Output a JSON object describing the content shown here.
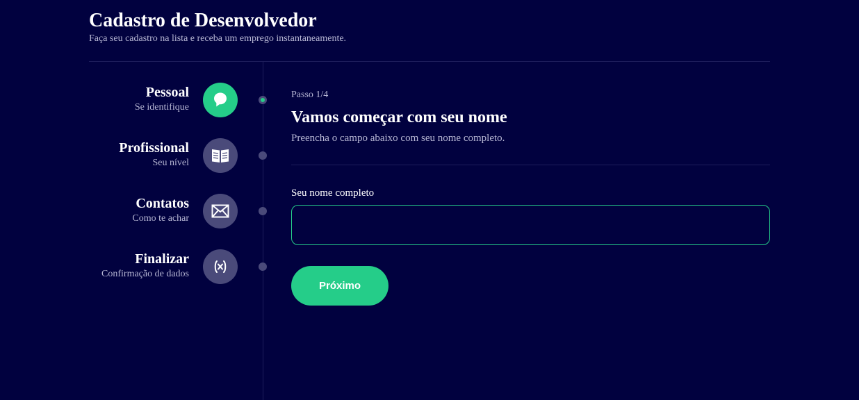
{
  "header": {
    "title": "Cadastro de Desenvolvedor",
    "subtitle": "Faça seu cadastro na lista e receba um emprego instantaneamente."
  },
  "steps": [
    {
      "title": "Pessoal",
      "subtitle": "Se identifique",
      "icon": "user-bubble-icon",
      "active": true
    },
    {
      "title": "Profissional",
      "subtitle": "Seu nível",
      "icon": "book-icon",
      "active": false
    },
    {
      "title": "Contatos",
      "subtitle": "Como te achar",
      "icon": "mail-icon",
      "active": false
    },
    {
      "title": "Finalizar",
      "subtitle": "Confirmação de dados",
      "icon": "variable-icon",
      "active": false
    }
  ],
  "content": {
    "step_count": "Passo 1/4",
    "title": "Vamos começar com seu nome",
    "description": "Preencha o campo abaixo com seu nome completo.",
    "name_field": {
      "label": "Seu nome completo",
      "value": "",
      "placeholder": ""
    },
    "next_label": "Próximo"
  },
  "colors": {
    "background": "#01013f",
    "accent": "#25cd89",
    "inactive": "#4a4a7a",
    "muted_text": "#b7b7d4",
    "divider": "#1e1e5c"
  }
}
